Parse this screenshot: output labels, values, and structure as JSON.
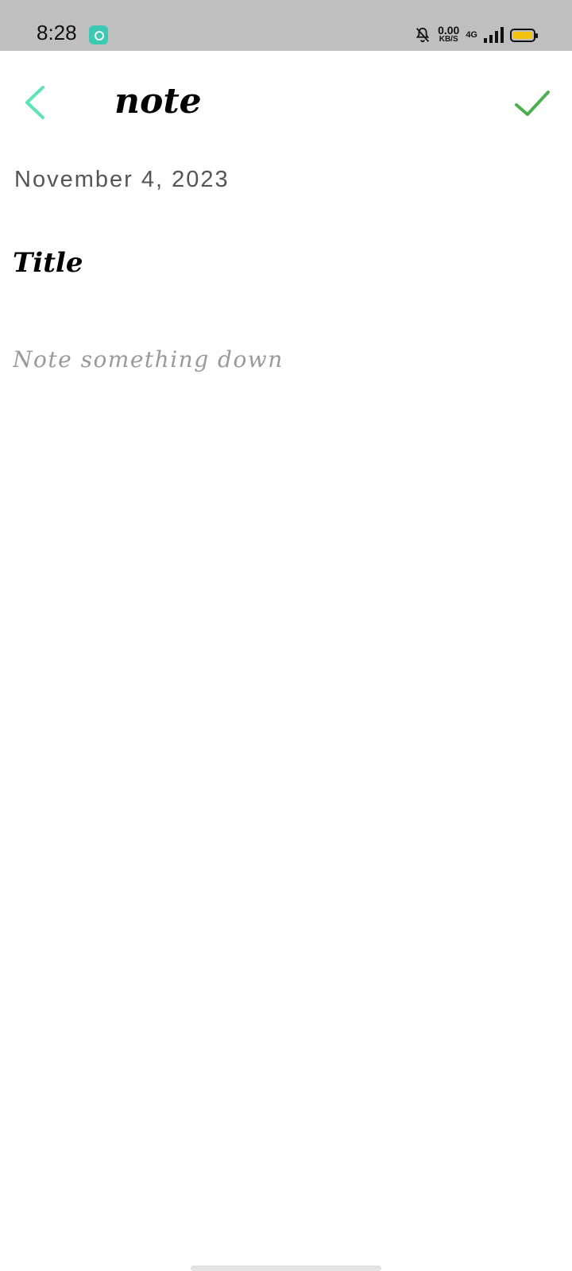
{
  "status_bar": {
    "time": "8:28",
    "speed_value": "0.00",
    "speed_unit": "KB/S",
    "network": "4G",
    "icons": [
      "notification-app-icon",
      "bell-muted-icon",
      "signal-icon",
      "battery-icon"
    ],
    "battery_color": "#f4c20d"
  },
  "header": {
    "title": "note",
    "back_icon": "chevron-left-icon",
    "save_icon": "checkmark-icon",
    "back_color": "#5ee3b4",
    "save_color": "#4caf50"
  },
  "note": {
    "date": "November 4, 2023",
    "title_placeholder": "Title",
    "title_value": "",
    "body_placeholder": "Note something down",
    "body_value": ""
  }
}
